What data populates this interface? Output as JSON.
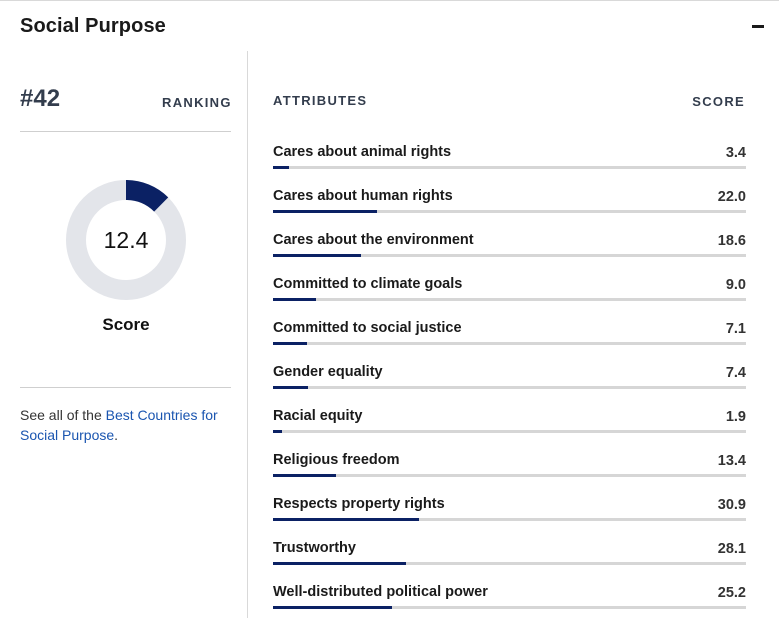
{
  "section": {
    "title": "Social Purpose"
  },
  "ranking": {
    "value": "#42",
    "label": "RANKING"
  },
  "score": {
    "value": "12.4",
    "caption": "Score",
    "max": 100,
    "fill_color": "#0b2164",
    "track_color": "#e3e5ea"
  },
  "footer": {
    "prefix": "See all of the ",
    "link_text": "Best Countries for Social Purpose",
    "suffix": "."
  },
  "table": {
    "attributes_header": "ATTRIBUTES",
    "score_header": "SCORE",
    "max": 100,
    "rows": [
      {
        "label": "Cares about animal rights",
        "score": "3.4"
      },
      {
        "label": "Cares about human rights",
        "score": "22.0"
      },
      {
        "label": "Cares about the environment",
        "score": "18.6"
      },
      {
        "label": "Committed to climate goals",
        "score": "9.0"
      },
      {
        "label": "Committed to social justice",
        "score": "7.1"
      },
      {
        "label": "Gender equality",
        "score": "7.4"
      },
      {
        "label": "Racial equity",
        "score": "1.9"
      },
      {
        "label": "Religious freedom",
        "score": "13.4"
      },
      {
        "label": "Respects property rights",
        "score": "30.9"
      },
      {
        "label": "Trustworthy",
        "score": "28.1"
      },
      {
        "label": "Well-distributed political power",
        "score": "25.2"
      }
    ]
  }
}
